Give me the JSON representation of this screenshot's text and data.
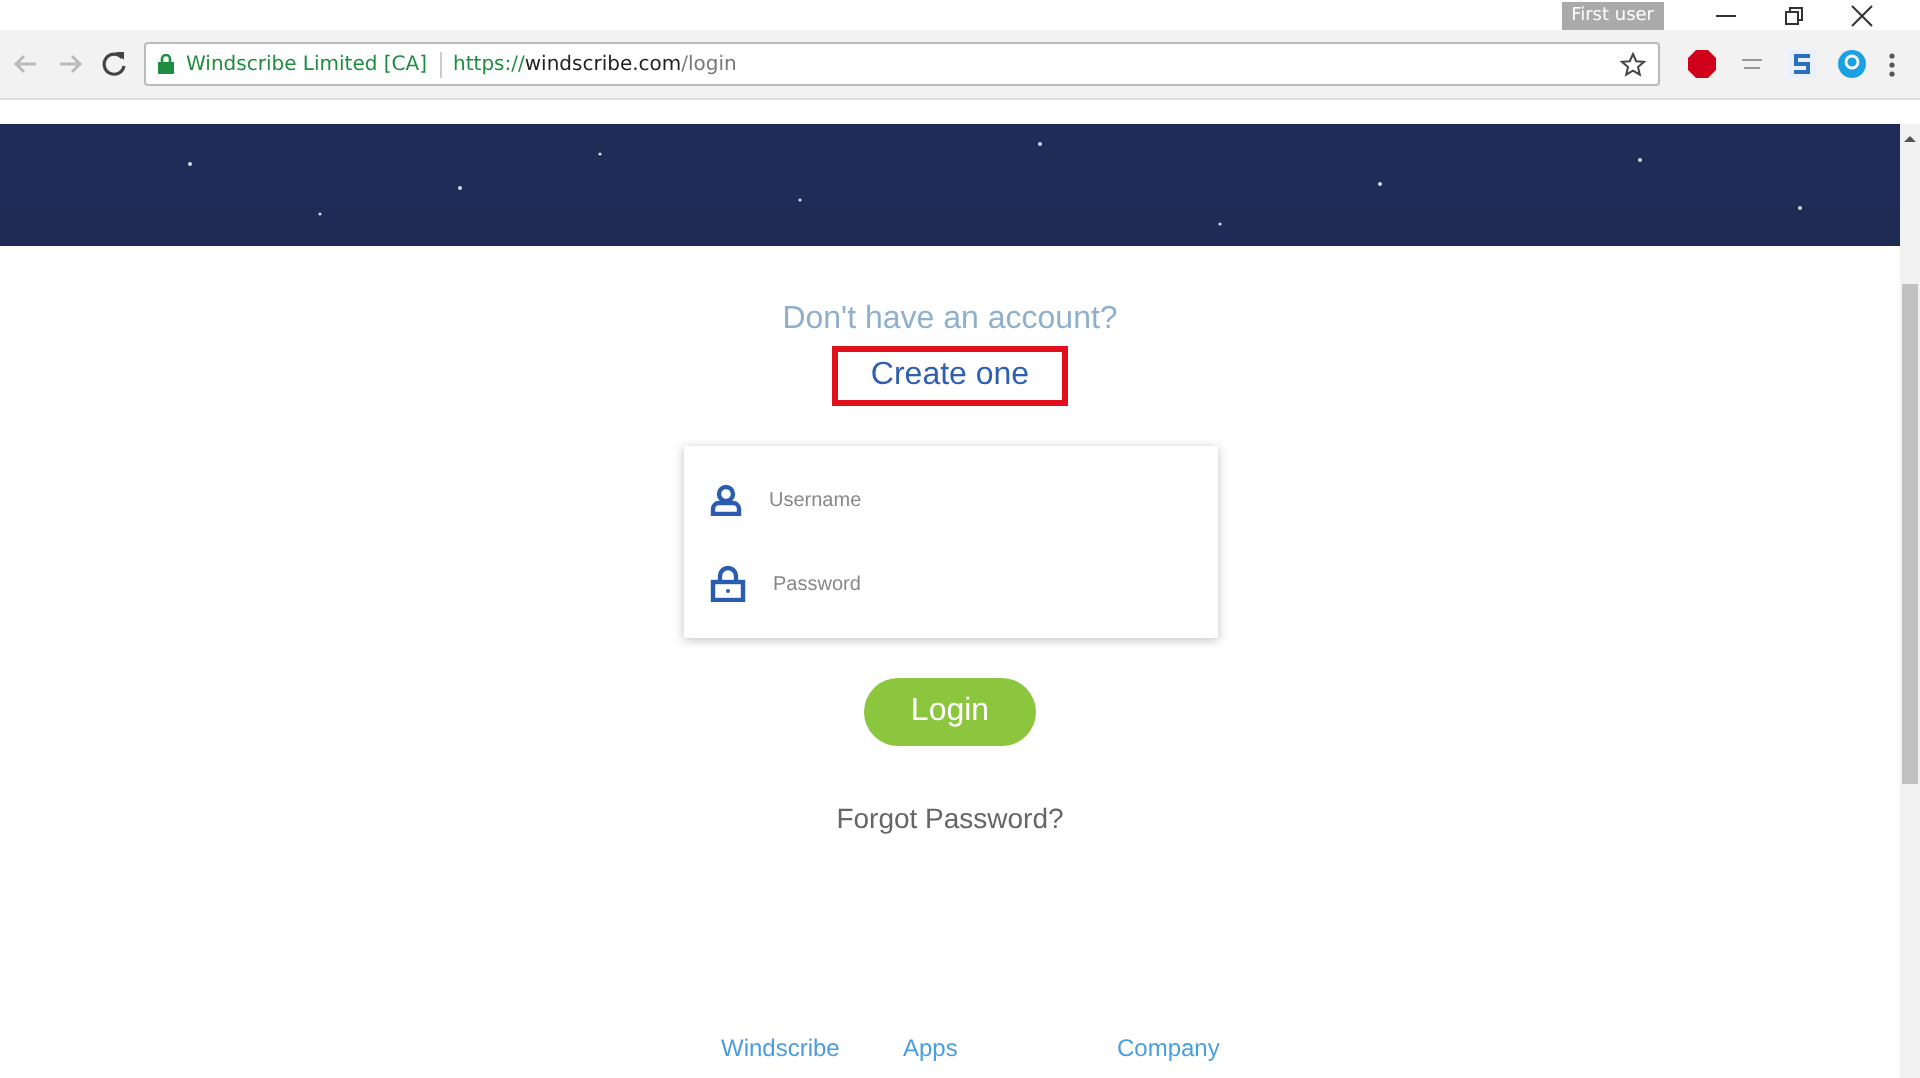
{
  "window": {
    "profile": "First user"
  },
  "address_bar": {
    "site_name": "Windscribe Limited [CA]",
    "url_scheme": "https://",
    "url_host": "windscribe.com",
    "url_path": "/login"
  },
  "prompt": "Don't have an account?",
  "create_link": {
    "label": "Create one",
    "highlighted": true
  },
  "form": {
    "fields": [
      {
        "kind": "user",
        "placeholder": "Username"
      },
      {
        "kind": "lock",
        "placeholder": "Password"
      }
    ]
  },
  "login_button": "Login",
  "forgot_link": "Forgot Password?",
  "footer_links": [
    "Windscribe",
    "Apps",
    "Company"
  ]
}
